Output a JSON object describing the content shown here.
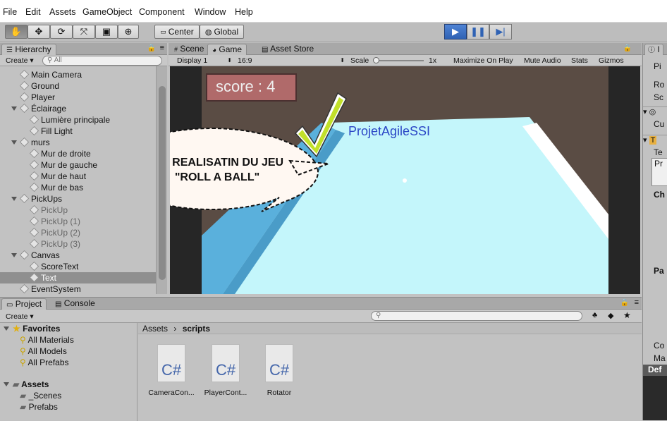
{
  "menu": [
    "File",
    "Edit",
    "Assets",
    "GameObject",
    "Component",
    "Window",
    "Help"
  ],
  "toolbar": {
    "pivot_label": "Center",
    "space_label": "Global"
  },
  "hierarchy": {
    "tab": "Hierarchy",
    "create": "Create",
    "search_placeholder": "All",
    "items": [
      {
        "label": "Main Camera",
        "indent": 0,
        "expand": false,
        "dim": false
      },
      {
        "label": "Ground",
        "indent": 0,
        "expand": false,
        "dim": false
      },
      {
        "label": "Player",
        "indent": 0,
        "expand": false,
        "dim": false
      },
      {
        "label": "Éclairage",
        "indent": 0,
        "expand": true,
        "dim": false
      },
      {
        "label": "Lumière principale",
        "indent": 1,
        "expand": false,
        "dim": false
      },
      {
        "label": "Fill Light",
        "indent": 1,
        "expand": false,
        "dim": false
      },
      {
        "label": "murs",
        "indent": 0,
        "expand": true,
        "dim": false
      },
      {
        "label": "Mur de droite",
        "indent": 1,
        "expand": false,
        "dim": false
      },
      {
        "label": "Mur de gauche",
        "indent": 1,
        "expand": false,
        "dim": false
      },
      {
        "label": "Mur de haut",
        "indent": 1,
        "expand": false,
        "dim": false
      },
      {
        "label": "Mur de bas",
        "indent": 1,
        "expand": false,
        "dim": false
      },
      {
        "label": "PickUps",
        "indent": 0,
        "expand": true,
        "dim": false
      },
      {
        "label": "PickUp",
        "indent": 1,
        "expand": false,
        "dim": true
      },
      {
        "label": "PickUp (1)",
        "indent": 1,
        "expand": false,
        "dim": true
      },
      {
        "label": "PickUp (2)",
        "indent": 1,
        "expand": false,
        "dim": true
      },
      {
        "label": "PickUp (3)",
        "indent": 1,
        "expand": false,
        "dim": true
      },
      {
        "label": "Canvas",
        "indent": 0,
        "expand": true,
        "dim": false
      },
      {
        "label": "ScoreText",
        "indent": 1,
        "expand": false,
        "dim": false
      },
      {
        "label": "Text",
        "indent": 1,
        "expand": false,
        "dim": false,
        "selected": true
      },
      {
        "label": "EventSystem",
        "indent": 0,
        "expand": false,
        "dim": false
      }
    ]
  },
  "game_view": {
    "tabs": [
      "Scene",
      "Game",
      "Asset Store"
    ],
    "display": "Display 1",
    "aspect": "16:9",
    "scale_label": "Scale",
    "scale_value": "1x",
    "buttons": [
      "Maximize On Play",
      "Mute Audio",
      "Stats",
      "Gizmos"
    ],
    "score_text": "score : 4",
    "title_text": "ProjetAgileSSI",
    "callout": "FIN REALISATIN DU JEU \"ROLL A BALL\""
  },
  "project": {
    "tabs": [
      "Project",
      "Console"
    ],
    "create": "Create",
    "favorites_label": "Favorites",
    "favorites": [
      "All Materials",
      "All Models",
      "All Prefabs"
    ],
    "assets_label": "Assets",
    "assets_children": [
      "_Scenes",
      "Prefabs"
    ],
    "breadcrumb": [
      "Assets",
      "scripts"
    ],
    "files": [
      {
        "name": "CameraCon...",
        "ext": "C#"
      },
      {
        "name": "PlayerCont...",
        "ext": "C#"
      },
      {
        "name": "Rotator",
        "ext": "C#"
      }
    ]
  },
  "inspector": {
    "tab": "I",
    "fragments": [
      "Pi",
      "Ro",
      "Sc",
      "Cu",
      "Te",
      "Pr",
      "Ch",
      "Pa",
      "Co",
      "Ma",
      "Def"
    ]
  },
  "colors": {
    "play_blue": "#3a6fc4",
    "selection": "#8f8f8f",
    "floor": "#c4f6fb",
    "score_box": "#b06a6a"
  }
}
